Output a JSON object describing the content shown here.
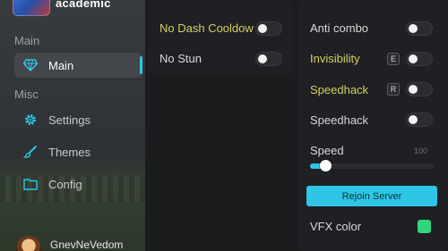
{
  "sidebar": {
    "brand": "academic",
    "sections": {
      "main": "Main",
      "misc": "Misc"
    },
    "items": {
      "main": "Main",
      "settings": "Settings",
      "themes": "Themes",
      "config": "Config"
    },
    "user": {
      "name": "GnevNeVedom"
    }
  },
  "panel_left": {
    "no_dash_cooldown": {
      "label": "No Dash Cooldow",
      "enabled": false
    },
    "no_stun": {
      "label": "No Stun",
      "enabled": false
    }
  },
  "panel_right": {
    "anti_combo": {
      "label": "Anti combo",
      "enabled": false
    },
    "invisibility": {
      "label": "Invisibility",
      "keybind": "E",
      "enabled": false
    },
    "speedhack_bind": {
      "label": "Speedhack",
      "keybind": "R",
      "enabled": false
    },
    "speedhack": {
      "label": "Speedhack",
      "enabled": false
    },
    "speed": {
      "label": "Speed",
      "max_text": "100",
      "value_fraction": 0.09
    },
    "rejoin_label": "Rejoin Server",
    "vfx_color": {
      "label": "VFX color",
      "color": "#2fd67a"
    }
  },
  "colors": {
    "accent": "#2ec6e6",
    "highlight_text": "#d4d05e"
  }
}
